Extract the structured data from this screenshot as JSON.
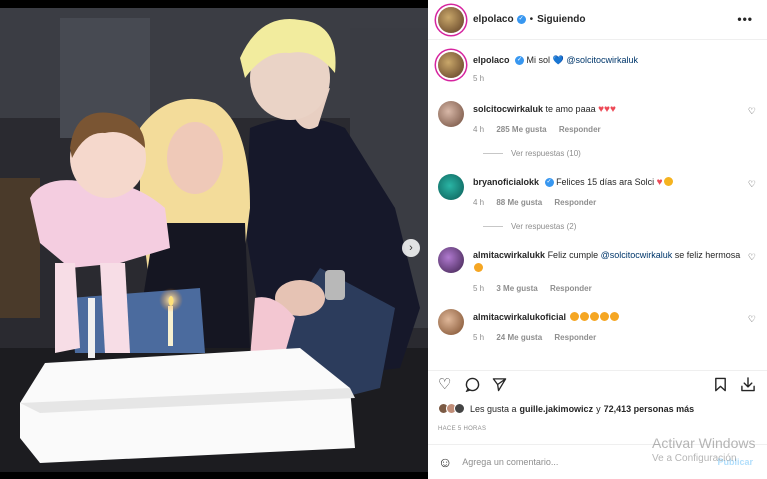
{
  "header": {
    "username": "elpolaco",
    "follow": "Siguiendo",
    "more": "•••"
  },
  "caption": {
    "username": "elpolaco",
    "text": "Mi sol",
    "emoji": "💙",
    "mention": "@solcitocwirkaluk",
    "time": "5 h"
  },
  "comments": [
    {
      "username": "solcitocwirkaluk",
      "text": "te amo paaa",
      "emoji": "♥♥♥",
      "time": "4 h",
      "likes": "285 Me gusta",
      "reply": "Responder",
      "replies": "Ver respuestas (10)"
    },
    {
      "username": "bryanoficialokk",
      "text": "Felices 15 días ara Solci",
      "emoji": "♥",
      "time": "4 h",
      "likes": "88 Me gusta",
      "reply": "Responder",
      "replies": "Ver respuestas (2)"
    },
    {
      "username": "almitacwirkalukk",
      "text": "Feliz cumple",
      "mention": "@solcitocwirkaluk",
      "text2": "se feliz hermosa",
      "time": "5 h",
      "likes": "3 Me gusta",
      "reply": "Responder"
    },
    {
      "username": "almitacwirkalukoficial",
      "text": "",
      "time": "5 h",
      "likes": "24 Me gusta",
      "reply": "Responder"
    }
  ],
  "likes": {
    "prefix": "Les gusta a",
    "user": "guille.jakimowicz",
    "middle": "y",
    "count": "72,413 personas más"
  },
  "time_ago": "HACE 5 HORAS",
  "add_comment": {
    "placeholder": "Agrega un comentario...",
    "publish": "Publicar"
  },
  "watermark": {
    "line1": "Activar Windows",
    "line2": "Ve a Configuración"
  },
  "icons": {
    "like": "heart-icon",
    "comment": "comment-icon",
    "share": "send-icon",
    "save": "bookmark-icon",
    "download": "download-icon",
    "emoji": "emoji-icon",
    "next": "chevron-right-icon"
  },
  "colors": {
    "verified": "#3897f0",
    "mention": "#00376b",
    "heart": "#ed4956"
  }
}
